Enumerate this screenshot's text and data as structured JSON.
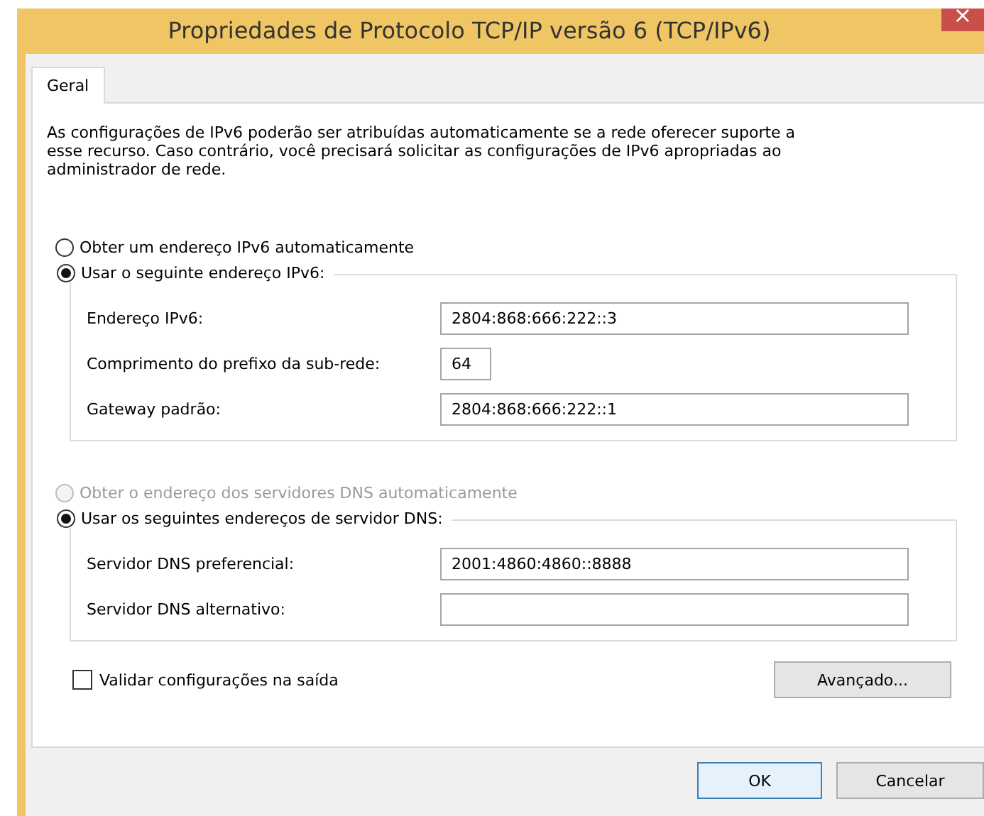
{
  "window": {
    "title": "Propriedades de Protocolo TCP/IP versão 6 (TCP/IPv6)",
    "close": "×"
  },
  "tabs": [
    {
      "label": "Geral",
      "selected": true
    }
  ],
  "description": "As configurações de IPv6 poderão ser atribuídas automaticamente se a rede oferecer suporte a esse recurso. Caso contrário, você precisará solicitar as configurações de IPv6 apropriadas ao administrador de rede.",
  "address_options": [
    {
      "label": "Obter um endereço IPv6 automaticamente",
      "selected": false,
      "disabled": false
    },
    {
      "label": "Usar o seguinte endereço IPv6:",
      "selected": true,
      "disabled": false
    }
  ],
  "address_fields": [
    {
      "label": "Endereço IPv6:",
      "value": "2804:868:666:222::3",
      "kind": "wide"
    },
    {
      "label": "Comprimento do prefixo da sub-rede:",
      "value": "64",
      "kind": "short"
    },
    {
      "label": "Gateway padrão:",
      "value": "2804:868:666:222::1",
      "kind": "wide"
    }
  ],
  "dns_options": [
    {
      "label": "Obter o endereço dos servidores DNS automaticamente",
      "selected": false,
      "disabled": true
    },
    {
      "label": "Usar os seguintes endereços de servidor DNS:",
      "selected": true,
      "disabled": false
    }
  ],
  "dns_fields": [
    {
      "label": "Servidor DNS preferencial:",
      "value": "2001:4860:4860::8888",
      "kind": "wide"
    },
    {
      "label": "Servidor DNS alternativo:",
      "kind": "wide"
    }
  ],
  "validate": {
    "label": "Validar configurações na saída",
    "checked": false
  },
  "advanced_button": "Avançado...",
  "buttons": [
    {
      "label": "OK",
      "kind": "default"
    },
    {
      "label": "Cancelar",
      "kind": "normal"
    }
  ]
}
